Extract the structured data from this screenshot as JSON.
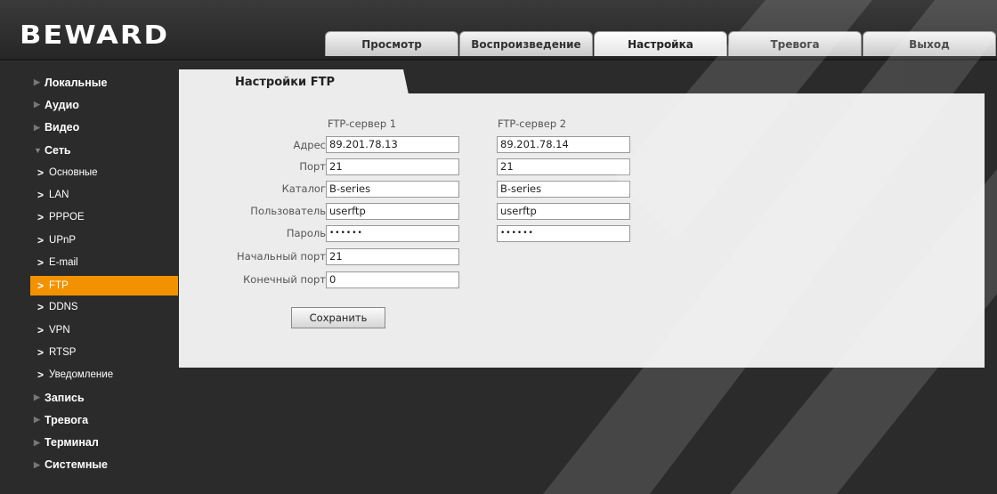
{
  "brand": {
    "logo_text": "BEWARD"
  },
  "tabs": [
    {
      "label": "Просмотр",
      "active": false
    },
    {
      "label": "Воспроизведение",
      "active": false
    },
    {
      "label": "Настройка",
      "active": true
    },
    {
      "label": "Тревога",
      "active": false
    },
    {
      "label": "Выход",
      "active": false
    }
  ],
  "sidebar": {
    "items": [
      {
        "label": "Локальные"
      },
      {
        "label": "Аудио"
      },
      {
        "label": "Видео"
      },
      {
        "label": "Сеть"
      }
    ],
    "network_sub": [
      {
        "label": "Основные"
      },
      {
        "label": "LAN"
      },
      {
        "label": "PPPOE"
      },
      {
        "label": "UPnP"
      },
      {
        "label": "E-mail"
      },
      {
        "label": "FTP",
        "active": true
      },
      {
        "label": "DDNS"
      },
      {
        "label": "VPN"
      },
      {
        "label": "RTSP"
      },
      {
        "label": "Уведомление"
      }
    ],
    "items_after": [
      {
        "label": "Запись"
      },
      {
        "label": "Тревога"
      },
      {
        "label": "Терминал"
      },
      {
        "label": "Системные"
      }
    ],
    "accent_color": "#f39200"
  },
  "ftp": {
    "title": "Настройки FTP",
    "server1_heading": "FTP-сервер 1",
    "server2_heading": "FTP-сервер 2",
    "labels": {
      "address": "Адрес",
      "port": "Порт",
      "directory": "Каталог",
      "user": "Пользователь",
      "password": "Пароль",
      "start_port": "Начальный порт",
      "end_port": "Конечный порт"
    },
    "server1": {
      "address": "89.201.78.13",
      "port": "21",
      "directory": "B-series",
      "user": "userftp",
      "password": "••••••"
    },
    "server2": {
      "address": "89.201.78.14",
      "port": "21",
      "directory": "B-series",
      "user": "userftp",
      "password": "••••••"
    },
    "start_port": "21",
    "end_port": "0",
    "save_label": "Сохранить"
  }
}
